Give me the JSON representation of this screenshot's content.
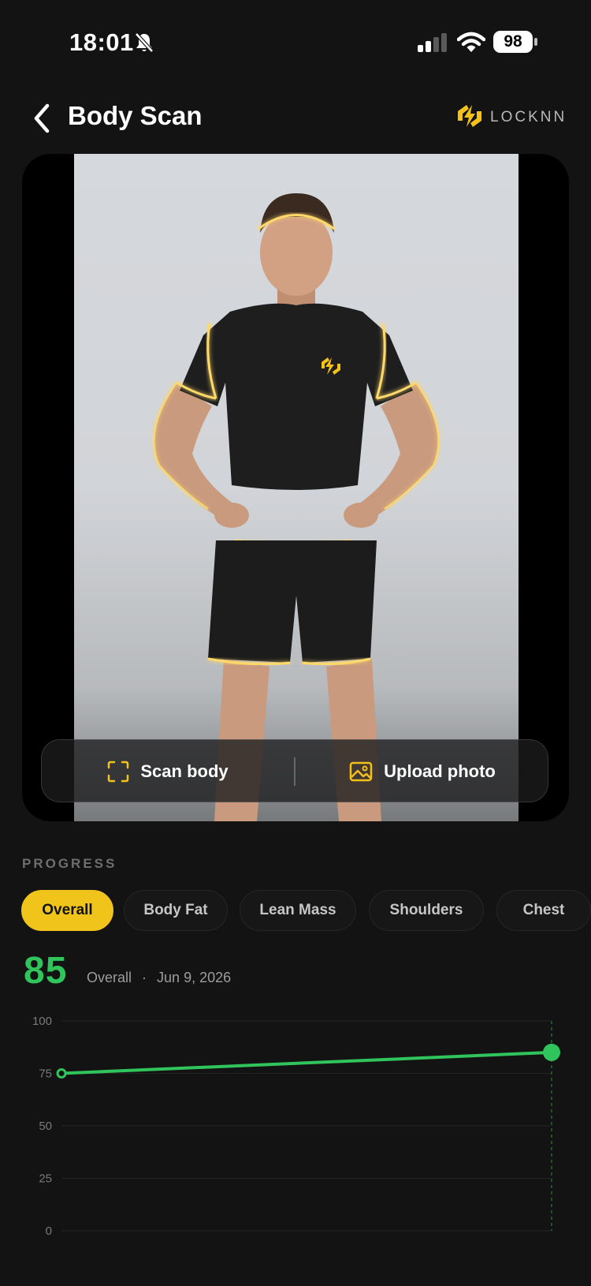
{
  "status_bar": {
    "time": "18:01",
    "battery": "98"
  },
  "header": {
    "title": "Body Scan",
    "brand": "LOCKNN",
    "brand_color": "#f2c21b"
  },
  "scan_card": {
    "scan_label": "Scan body",
    "upload_label": "Upload photo"
  },
  "progress": {
    "section_label": "PROGRESS",
    "tabs": [
      {
        "label": "Overall",
        "active": true
      },
      {
        "label": "Body Fat",
        "active": false
      },
      {
        "label": "Lean Mass",
        "active": false
      },
      {
        "label": "Shoulders",
        "active": false
      },
      {
        "label": "Chest",
        "active": false
      }
    ],
    "score": "85",
    "score_category": "Overall",
    "score_separator": "·",
    "score_date": "Jun 9, 2026"
  },
  "chart_data": {
    "type": "line",
    "ylim": [
      0,
      100
    ],
    "yticks": [
      "100",
      "75",
      "50",
      "25",
      "0"
    ],
    "series": [
      {
        "values": [
          75,
          85
        ],
        "color": "#2fc45c"
      }
    ],
    "grid": true
  }
}
